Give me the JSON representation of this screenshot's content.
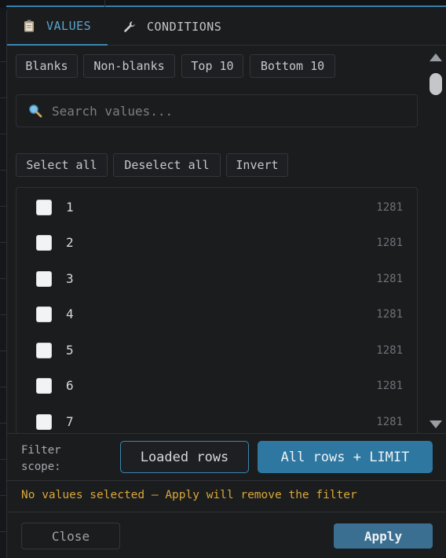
{
  "tabs": [
    {
      "label": "VALUES",
      "icon": "clipboard-icon",
      "active": true
    },
    {
      "label": "CONDITIONS",
      "icon": "wrench-icon",
      "active": false
    }
  ],
  "quick_filters": [
    "Blanks",
    "Non-blanks",
    "Top 10",
    "Bottom 10"
  ],
  "search": {
    "placeholder": "Search values...",
    "value": ""
  },
  "selection_actions": [
    "Select all",
    "Deselect all",
    "Invert"
  ],
  "values": [
    {
      "label": "1",
      "count": "1281",
      "checked": false
    },
    {
      "label": "2",
      "count": "1281",
      "checked": false
    },
    {
      "label": "3",
      "count": "1281",
      "checked": false
    },
    {
      "label": "4",
      "count": "1281",
      "checked": false
    },
    {
      "label": "5",
      "count": "1281",
      "checked": false
    },
    {
      "label": "6",
      "count": "1281",
      "checked": false
    },
    {
      "label": "7",
      "count": "1281",
      "checked": false
    }
  ],
  "scope": {
    "label": "Filter scope:",
    "options": [
      "Loaded rows",
      "All rows + LIMIT"
    ],
    "selected": "All rows + LIMIT"
  },
  "warning": "No values selected — Apply will remove the filter",
  "footer": {
    "close_label": "Close",
    "apply_label": "Apply"
  },
  "colors": {
    "accent": "#3a87b3",
    "primary_button": "#2d77a1",
    "warning": "#d9a838",
    "background": "#1b1c1e"
  }
}
